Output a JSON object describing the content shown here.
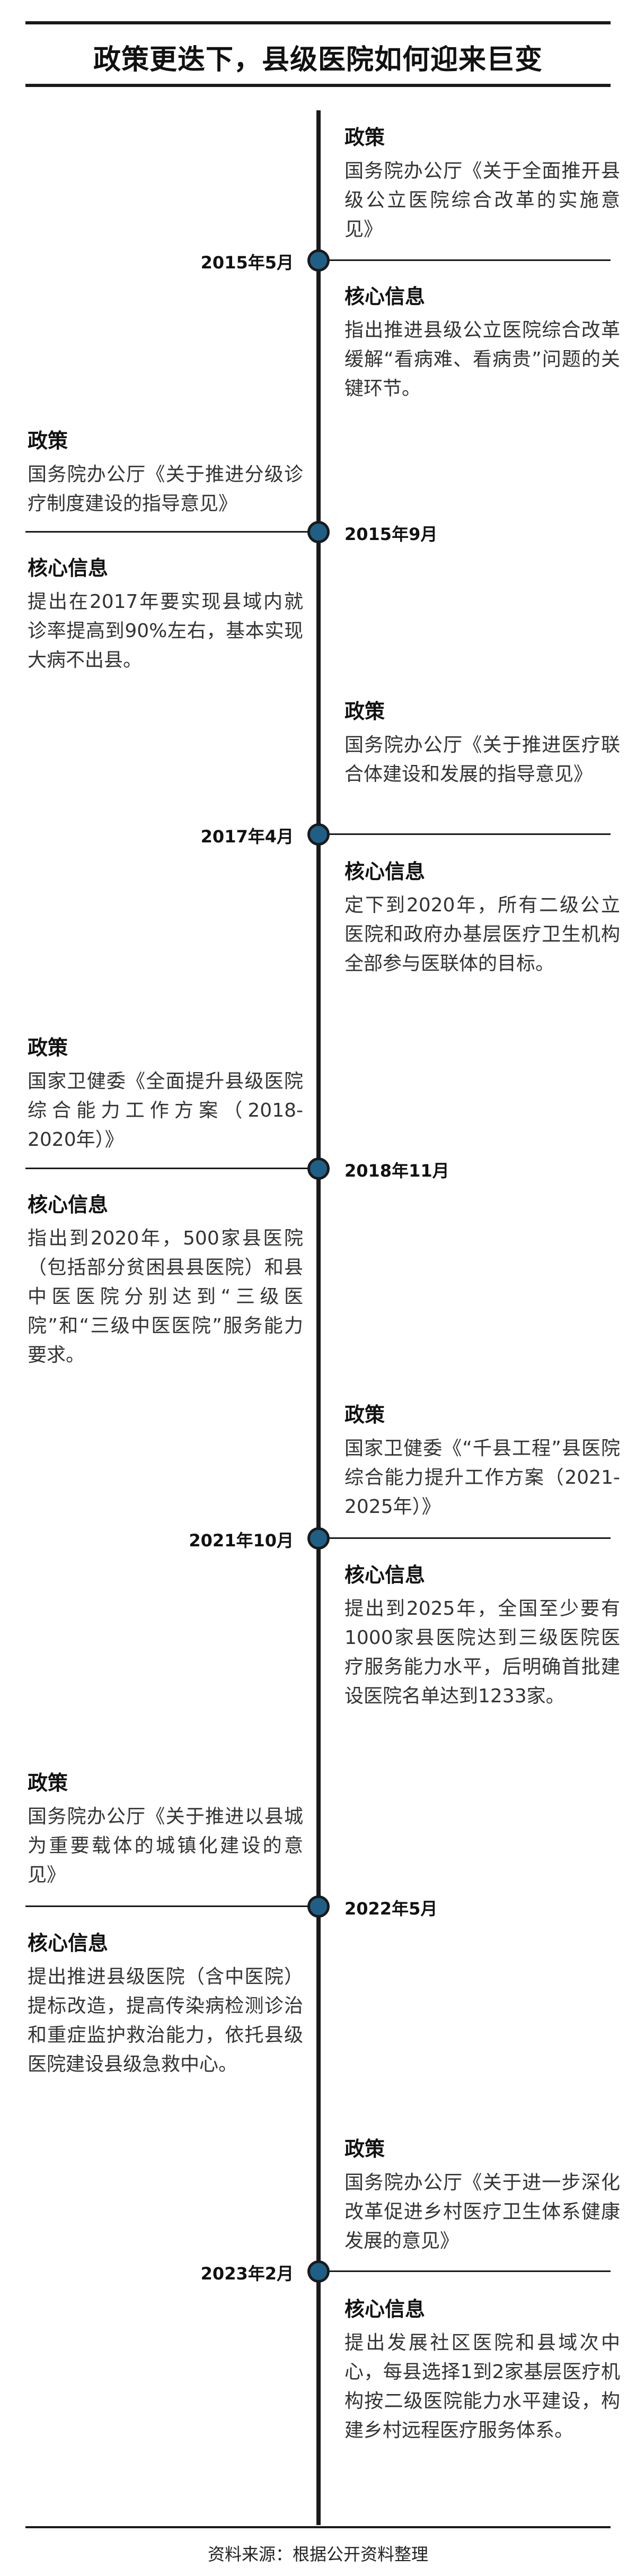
{
  "title": "政策更迭下，县级医院如何迎来巨变",
  "policy_label": "政策",
  "core_label": "核心信息",
  "entries": [
    {
      "date": "2015年5月",
      "policy": "国务院办公厅《关于全面推开县级公立医院综合改革的实施意见》",
      "core": "指出推进县级公立医院综合改革缓解“看病难、看病贵”问题的关键环节。"
    },
    {
      "date": "2015年9月",
      "policy": "国务院办公厅《关于推进分级诊疗制度建设的指导意见》",
      "core": "提出在2017年要实现县域内就诊率提高到90%左右，基本实现大病不出县。"
    },
    {
      "date": "2017年4月",
      "policy": "国务院办公厅《关于推进医疗联合体建设和发展的指导意见》",
      "core": "定下到2020年，所有二级公立医院和政府办基层医疗卫生机构全部参与医联体的目标。"
    },
    {
      "date": "2018年11月",
      "policy": "国家卫健委《全面提升县级医院综合能力工作方案（2018-2020年）》",
      "core": "指出到2020年，500家县医院（包括部分贫困县县医院）和县中医医院分别达到“三级医院”和“三级中医医院”服务能力要求。"
    },
    {
      "date": "2021年10月",
      "policy": "国家卫健委《“千县工程”县医院综合能力提升工作方案（2021-2025年）》",
      "core": "提出到2025年，全国至少要有1000家县医院达到三级医院医疗服务能力水平，后明确首批建设医院名单达到1233家。"
    },
    {
      "date": "2022年5月",
      "policy": "国务院办公厅《关于推进以县城为重要载体的城镇化建设的意见》",
      "core": "提出推进县级医院（含中医院）提标改造，提高传染病检测诊治和重症监护救治能力，依托县级医院建设县级急救中心。"
    },
    {
      "date": "2023年2月",
      "policy": "国务院办公厅《关于进一步深化改革促进乡村医疗卫生体系健康发展的意见》",
      "core": "提出发展社区医院和县域次中心，每县选择1到2家基层医疗机构按二级医院能力水平建设，构建乡村远程医疗服务体系。"
    }
  ],
  "source": "资料来源：根据公开资料整理"
}
